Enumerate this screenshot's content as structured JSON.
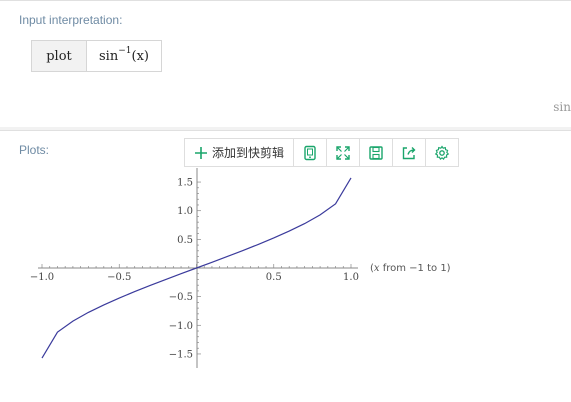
{
  "input": {
    "title": "Input interpretation:",
    "table": {
      "head": "plot",
      "expr_func": "sin",
      "expr_sup": "−1",
      "expr_arg": "(x)"
    },
    "cut_text": "sin"
  },
  "plots": {
    "title": "Plots:",
    "toolbar": {
      "add_label": "添加到快剪辑",
      "add_icon": "plus-icon",
      "icons": [
        "tablet-icon",
        "expand-icon",
        "save-icon",
        "share-icon",
        "gear-icon"
      ],
      "accent": "#1aa56b"
    },
    "range_text": "(x from −1 to 1)",
    "range_var": "x",
    "range_rest": " from −1 to 1)",
    "range_open": "(",
    "curve_color": "#3b3b9c"
  },
  "chart_data": {
    "type": "line",
    "function": "asin(x)",
    "xlim": [
      -1,
      1
    ],
    "ylim": [
      -1.5708,
      1.5708
    ],
    "x_ticks": [
      "−1.0",
      "−0.5",
      "0.5",
      "1.0"
    ],
    "y_ticks": [
      "1.5",
      "1.0",
      "0.5",
      "−0.5",
      "−1.0",
      "−1.5"
    ],
    "x_tick_values": [
      -1.0,
      -0.5,
      0.5,
      1.0
    ],
    "y_tick_values": [
      1.5,
      1.0,
      0.5,
      -0.5,
      -1.0,
      -1.5
    ],
    "series": [
      {
        "x": [
          -1.0,
          -0.9,
          -0.8,
          -0.7,
          -0.6,
          -0.5,
          -0.4,
          -0.3,
          -0.2,
          -0.1,
          0.0,
          0.1,
          0.2,
          0.3,
          0.4,
          0.5,
          0.6,
          0.7,
          0.8,
          0.9,
          1.0
        ],
        "y": [
          -1.571,
          -1.12,
          -0.927,
          -0.775,
          -0.644,
          -0.524,
          -0.412,
          -0.305,
          -0.201,
          -0.1,
          0.0,
          0.1,
          0.201,
          0.305,
          0.412,
          0.524,
          0.644,
          0.775,
          0.927,
          1.12,
          1.571
        ]
      }
    ]
  }
}
